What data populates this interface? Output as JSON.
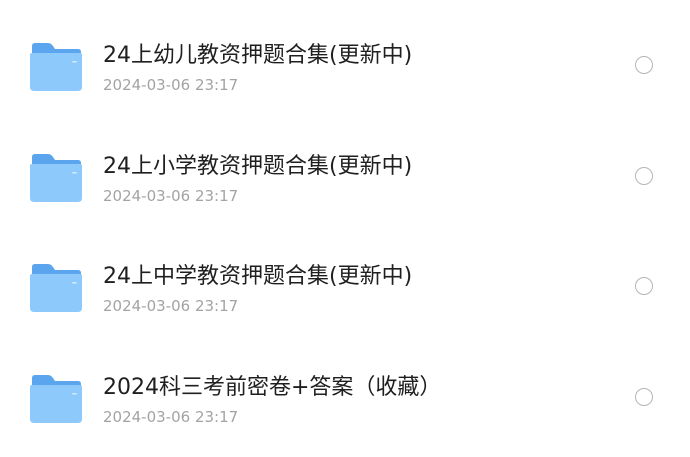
{
  "files": [
    {
      "name": "24上幼儿教资押题合集(更新中)",
      "date": "2024-03-06 23:17",
      "icon": "folder-icon",
      "selected": false
    },
    {
      "name": "24上小学教资押题合集(更新中)",
      "date": "2024-03-06 23:17",
      "icon": "folder-icon",
      "selected": false
    },
    {
      "name": "24上中学教资押题合集(更新中)",
      "date": "2024-03-06 23:17",
      "icon": "folder-icon",
      "selected": false
    },
    {
      "name": "2024科三考前密卷+答案（收藏）",
      "date": "2024-03-06 23:17",
      "icon": "folder-icon",
      "selected": false
    }
  ],
  "colors": {
    "folder_back": "#5aa5ee",
    "folder_front": "#8ec9fb",
    "title_text": "#1f1f1f",
    "date_text": "#a3a3a3",
    "radio_border": "#b5b5b5"
  }
}
